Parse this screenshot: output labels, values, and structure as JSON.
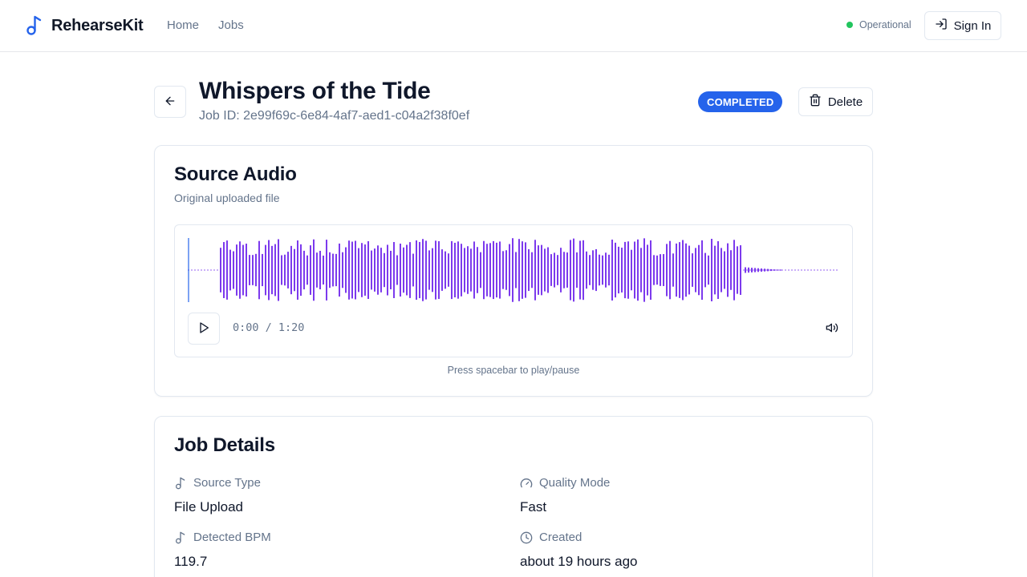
{
  "header": {
    "brand": "RehearseKit",
    "nav": [
      "Home",
      "Jobs"
    ],
    "status": "Operational",
    "signin_label": "Sign In",
    "colors": {
      "status_dot": "#22c55e",
      "accent": "#2563eb"
    }
  },
  "job": {
    "title": "Whispers of the Tide",
    "job_id": "Job ID: 2e99f69c-6e84-4af7-aed1-c04a2f38f0ef",
    "status_badge": "COMPLETED",
    "delete_label": "Delete"
  },
  "source_audio": {
    "title": "Source Audio",
    "subtitle": "Original uploaded file",
    "time": "0:00 / 1:20",
    "progress": 0,
    "hint": "Press spacebar to play/pause",
    "waveform_color": "#7c3aed"
  },
  "job_details": {
    "title": "Job Details",
    "items": [
      {
        "label": "Source Type",
        "value": "File Upload",
        "icon": "music-note-icon"
      },
      {
        "label": "Quality Mode",
        "value": "Fast",
        "icon": "gauge-icon"
      },
      {
        "label": "Detected BPM",
        "value": "119.7",
        "icon": "music-note-icon"
      },
      {
        "label": "Created",
        "value": "about 19 hours ago",
        "icon": "clock-icon"
      }
    ]
  }
}
